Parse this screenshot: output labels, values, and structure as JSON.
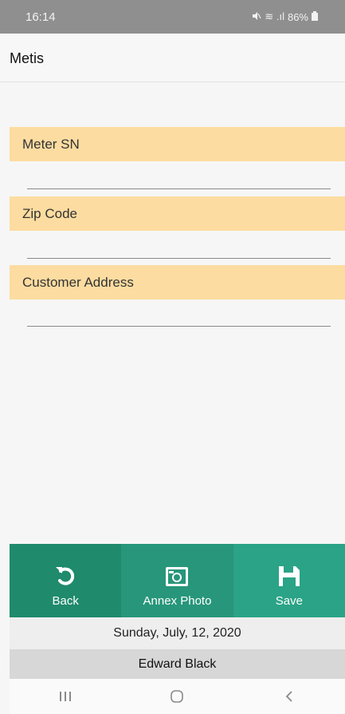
{
  "status_bar": {
    "time": "16:14",
    "signal_text": "≋ .ıl",
    "battery": "86%"
  },
  "app_bar": {
    "title": "Metis"
  },
  "form": {
    "fields": [
      {
        "label": "Meter SN",
        "value": "",
        "placeholder": ""
      },
      {
        "label": "Zip Code",
        "value": "",
        "placeholder": ""
      },
      {
        "label": "Customer Address",
        "value": "",
        "placeholder": ""
      }
    ]
  },
  "toolbar": {
    "back_label": "Back",
    "photo_label": "Annex Photo",
    "save_label": "Save",
    "colors": {
      "back": "#1f8a6c",
      "photo": "#27967a",
      "save": "#2aa386"
    }
  },
  "footer": {
    "date": "Sunday, July, 12, 2020",
    "user": "Edward Black"
  },
  "nav": {
    "icons": [
      "recent-apps-icon",
      "home-icon",
      "back-nav-icon"
    ]
  }
}
